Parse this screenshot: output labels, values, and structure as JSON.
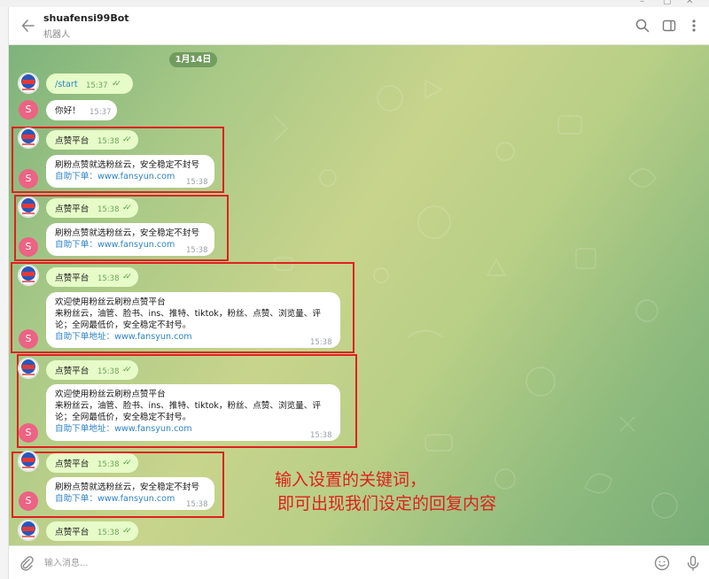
{
  "header": {
    "title": "shuafensi99Bot",
    "subtitle": "机器人"
  },
  "chat": {
    "date_badge": "1月14日",
    "messages": [
      {
        "text": "/start",
        "time": "15:37"
      },
      {
        "text": "你好！",
        "time": "15:37"
      },
      {
        "text": "点赞平台",
        "time": "15:38"
      },
      {
        "line1": "刷粉点赞就选粉丝云，安全稳定不封号",
        "link": "自助下单：www.fansyun.com",
        "time": "15:38"
      },
      {
        "text": "点赞平台",
        "time": "15:38"
      },
      {
        "line1": "刷粉点赞就选粉丝云，安全稳定不封号",
        "link": "自助下单：www.fansyun.com",
        "time": "15:38"
      },
      {
        "text": "点赞平台",
        "time": "15:38"
      },
      {
        "line1": "欢迎使用粉丝云刷粉点赞平台",
        "line2": "来粉丝云，油管、脸书、ins、推特、tiktok，粉丝、点赞、浏览量、评",
        "line3": "论；全网最低价，安全稳定不封号。",
        "link": "自助下单地址：www.fansyun.com",
        "time": "15:38"
      },
      {
        "text": "点赞平台",
        "time": "15:38"
      },
      {
        "line1": "欢迎使用粉丝云刷粉点赞平台",
        "line2": "来粉丝云，油管、脸书、ins、推特、tiktok，粉丝、点赞、浏览量、评",
        "line3": "论；全网最低价，安全稳定不封号。",
        "link": "自助下单地址：www.fansyun.com",
        "time": "15:38"
      },
      {
        "text": "点赞平台",
        "time": "15:38"
      },
      {
        "line1": "刷粉点赞就选粉丝云，安全稳定不封号",
        "link": "自助下单：www.fansyun.com",
        "time": "15:38"
      },
      {
        "text": "点赞平台",
        "time": "15:38"
      }
    ],
    "user_avatar_letter": "S"
  },
  "annotation": {
    "line1": "输入设置的关键词，",
    "line2": "即可出现我们设定的回复内容",
    "color": "#e0201d"
  },
  "composer": {
    "placeholder": "输入消息..."
  },
  "icons": {
    "back": "back-arrow-icon",
    "search": "search-icon",
    "sidebar": "sidebar-toggle-icon",
    "menu": "more-vertical-icon",
    "attach": "paperclip-icon",
    "emoji": "emoji-icon",
    "mic": "microphone-icon"
  },
  "colors": {
    "outgoing_bubble": "#e6fbc8",
    "incoming_bubble": "#ffffff",
    "link": "#2f84c6",
    "highlight_box": "#e02020",
    "avatar_s": "#ec6384"
  }
}
